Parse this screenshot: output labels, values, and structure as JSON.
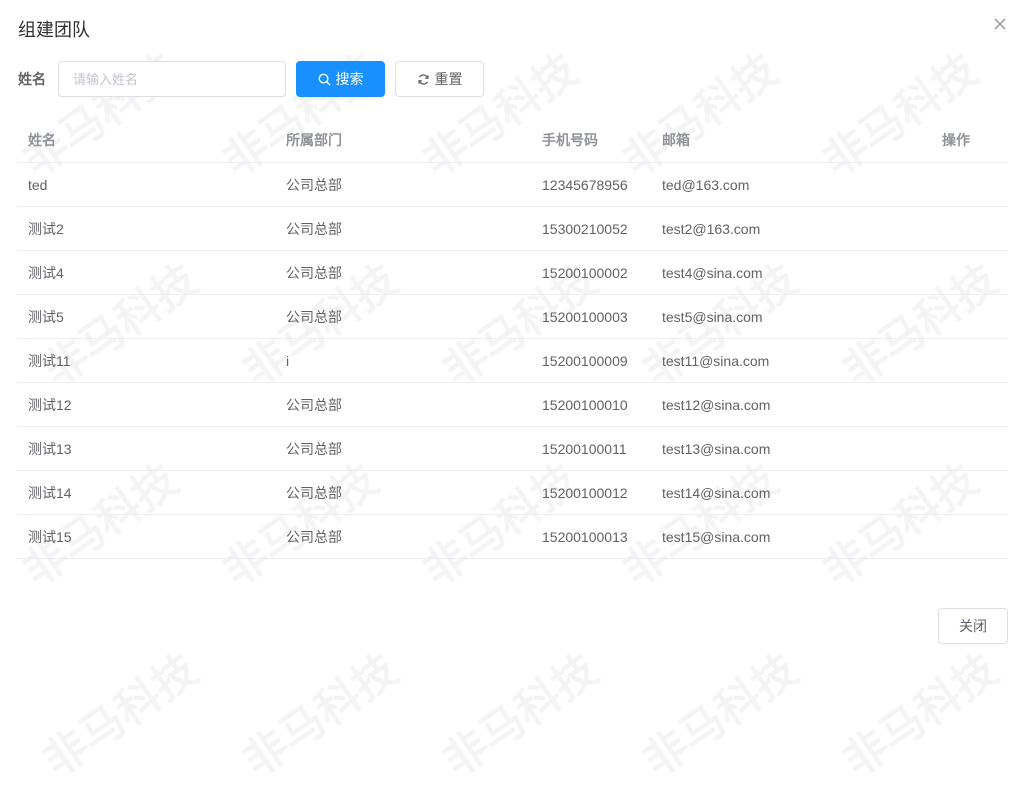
{
  "dialog": {
    "title": "组建团队",
    "close_icon": "close-icon"
  },
  "search": {
    "label": "姓名",
    "placeholder": "请输入姓名",
    "value": "",
    "search_button": "搜索",
    "search_icon": "search-icon",
    "reset_button": "重置",
    "reset_icon": "refresh-icon"
  },
  "table": {
    "columns": [
      "姓名",
      "所属部门",
      "手机号码",
      "邮箱",
      "操作"
    ],
    "rows": [
      {
        "name": "ted",
        "dept": "公司总部",
        "phone": "12345678956",
        "email": "ted@163.com"
      },
      {
        "name": "测试2",
        "dept": "公司总部",
        "phone": "15300210052",
        "email": "test2@163.com"
      },
      {
        "name": "测试4",
        "dept": "公司总部",
        "phone": "15200100002",
        "email": "test4@sina.com"
      },
      {
        "name": "测试5",
        "dept": "公司总部",
        "phone": "15200100003",
        "email": "test5@sina.com"
      },
      {
        "name": "测试11",
        "dept": "i",
        "phone": "15200100009",
        "email": "test11@sina.com"
      },
      {
        "name": "测试12",
        "dept": "公司总部",
        "phone": "15200100010",
        "email": "test12@sina.com"
      },
      {
        "name": "测试13",
        "dept": "公司总部",
        "phone": "15200100011",
        "email": "test13@sina.com"
      },
      {
        "name": "测试14",
        "dept": "公司总部",
        "phone": "15200100012",
        "email": "test14@sina.com"
      },
      {
        "name": "测试15",
        "dept": "公司总部",
        "phone": "15200100013",
        "email": "test15@sina.com"
      }
    ]
  },
  "footer": {
    "close_button": "关闭"
  },
  "watermark": {
    "text": "非马科技"
  },
  "colors": {
    "primary": "#1890ff",
    "border": "#dcdfe6",
    "text": "#606266",
    "header_text": "#909399",
    "title": "#303133"
  }
}
